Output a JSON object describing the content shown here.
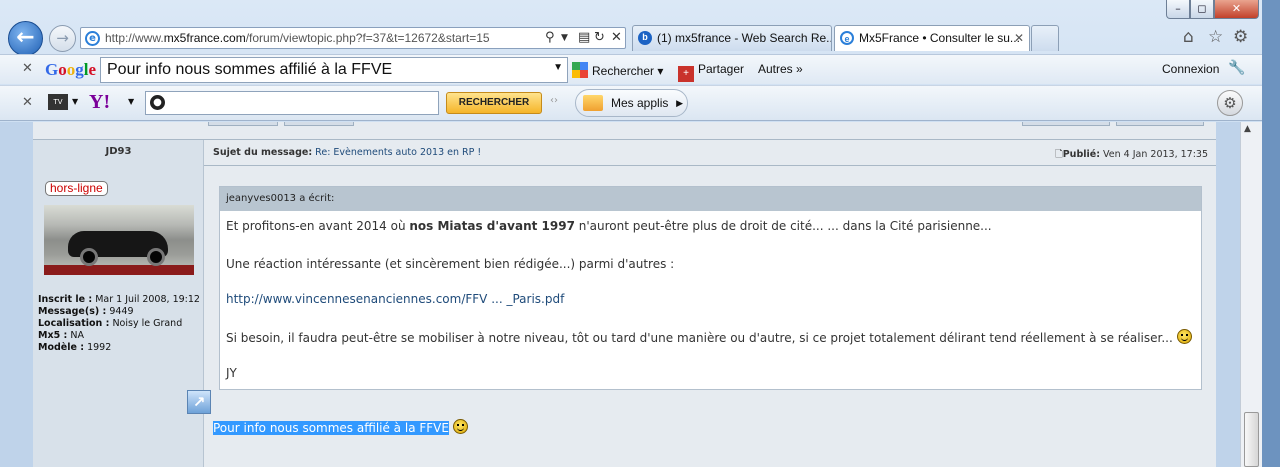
{
  "window": {
    "min_label": "–",
    "max_label": "◻",
    "close_label": "✕"
  },
  "nav": {
    "back_glyph": "←",
    "forward_glyph": "→"
  },
  "address": {
    "url_prefix": "http://www.",
    "url_domain": "mx5france.com",
    "url_suffix": "/forum/viewtopic.php?f=37&t=12672&start=15",
    "icons": [
      "search-icon",
      "dropdown-icon",
      "compat-icon",
      "refresh-icon",
      "stop-icon"
    ]
  },
  "tabs": [
    {
      "label": "(1) mx5france - Web Search Re...",
      "icon": "b"
    },
    {
      "label": "Mx5France • Consulter le su...",
      "icon": "e",
      "close": "✕"
    }
  ],
  "top_icons": [
    "home-icon",
    "star-icon",
    "gear-icon"
  ],
  "google_bar": {
    "logo": "Google",
    "query": "Pour info nous sommes affilié à la FFVE",
    "search_label": "Rechercher",
    "share_label": "Partager",
    "more_label": "Autres »",
    "login_label": "Connexion"
  },
  "yahoo_bar": {
    "logo": "Y!",
    "search_placeholder": "",
    "search_button": "RECHERCHER",
    "apps_label": "Mes applis"
  },
  "post": {
    "author": "JD93",
    "status": "hors-ligne",
    "info": [
      {
        "k": "Inscrit le :",
        "v": "Mar 1 Juil 2008, 19:12"
      },
      {
        "k": "Message(s) :",
        "v": "9449"
      },
      {
        "k": "Localisation :",
        "v": "Noisy le Grand"
      },
      {
        "k": "Mx5 :",
        "v": "NA"
      },
      {
        "k": "Modèle :",
        "v": "1992"
      }
    ],
    "subject_label": "Sujet du message:",
    "subject": "Re: Evènements auto 2013 en RP !",
    "posted_label": "Publié:",
    "posted": "Ven 4 Jan 2013, 17:35",
    "quote_header": "jeanyves0013 a écrit:",
    "quote_l1_pre": "Et profitons-en avant 2014 où ",
    "quote_l1_bold": "nos Miatas d'avant 1997",
    "quote_l1_post": " n'auront peut-être plus de droit de cité... ... dans la Cité parisienne...",
    "quote_l2": "Une réaction intéressante (et sincèrement bien rédigée...) parmi d'autres :",
    "quote_link": "http://www.vincennesenanciennes.com/FFV ... _Paris.pdf",
    "quote_l3": "Si besoin, il faudra peut-être se mobiliser à notre niveau, tôt ou tard d'une manière ou d'autre, si ce projet totalement délirant tend réellement à se réaliser...",
    "quote_sig": "JY",
    "reply": "Pour info nous sommes affilié à la FFVE"
  }
}
